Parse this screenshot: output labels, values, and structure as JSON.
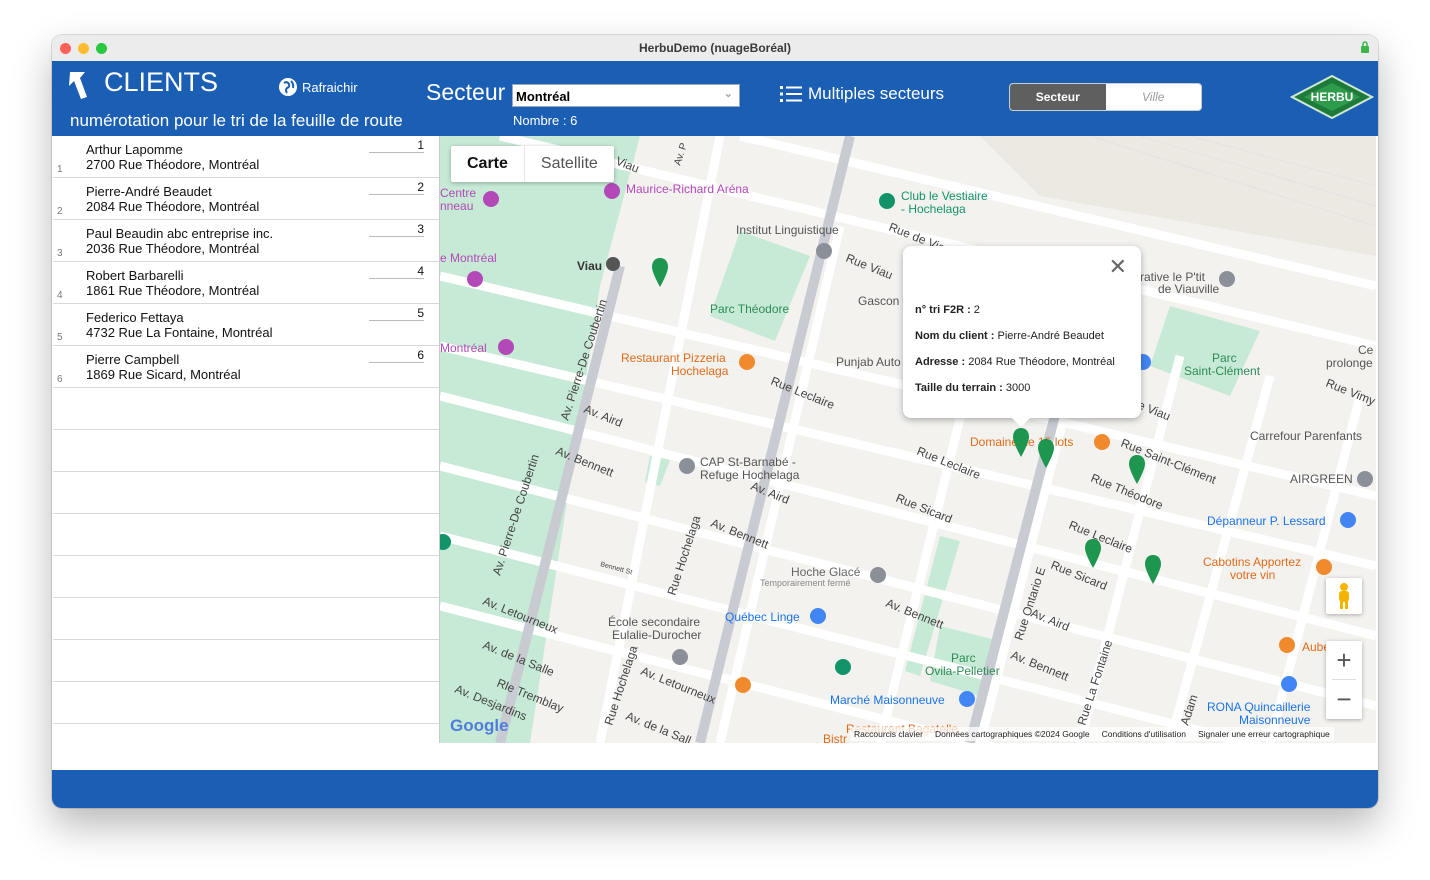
{
  "window": {
    "title": "HerbuDemo (nuageBoréal)"
  },
  "header": {
    "title": "CLIENTS",
    "subtitle": "numérotation pour le tri de la feuille de route",
    "refresh_label": "Rafraichir",
    "secteur_label": "Secteur",
    "secteur_value": "Montréal",
    "count_text": "Nombre : 6",
    "multi_label": "Multiples secteurs",
    "toggle_on": "Secteur",
    "toggle_off": "Ville",
    "logo_text": "HERBU",
    "colors": {
      "header_bg": "#1b5fb5",
      "footer_bg": "#1b5fb5"
    }
  },
  "clients": [
    {
      "rank": "1",
      "name": "Arthur Lapomme",
      "address": "2700 Rue Théodore, Montréal",
      "order": "1"
    },
    {
      "rank": "2",
      "name": "Pierre-André Beaudet",
      "address": "2084 Rue Théodore, Montréal",
      "order": "2"
    },
    {
      "rank": "3",
      "name": "Paul Beaudin abc entreprise inc.",
      "address": "2036 Rue Théodore, Montréal",
      "order": "3"
    },
    {
      "rank": "4",
      "name": "Robert Barbarelli",
      "address": "1861 Rue Théodore, Montréal",
      "order": "4"
    },
    {
      "rank": "5",
      "name": "Federico Fettaya",
      "address": "4732 Rue La Fontaine, Montréal",
      "order": "5"
    },
    {
      "rank": "6",
      "name": "Pierre Campbell",
      "address": "1869 Rue Sicard, Montréal",
      "order": "6"
    }
  ],
  "map": {
    "tab_map": "Carte",
    "tab_satellite": "Satellite",
    "popup": {
      "tri_label": "n° tri F2R :",
      "tri_value": "2",
      "name_label": "Nom du client :",
      "name_value": "Pierre-André Beaudet",
      "address_label": "Adresse :",
      "address_value": "2084 Rue Théodore, Montréal",
      "size_label": "Taille du terrain :",
      "size_value": "3000"
    },
    "google_logo": "Google",
    "attribution": [
      "Raccourcis clavier",
      "Données cartographiques ©2024 Google",
      "Conditions d'utilisation",
      "Signaler une erreur cartographique"
    ],
    "labels": {
      "maurice": "Maurice-Richard Aréna",
      "club1": "Club le Vestiaire",
      "club2": "- Hochelaga",
      "institut": "Institut Linguistique",
      "viau": "Viau",
      "parc_theodore": "Parc Théodore",
      "gascon": "Gascon",
      "punjab": "Punjab Auto",
      "resto1": "Restaurant Pizzeria",
      "resto2": "Hochelaga",
      "rue_leclaire": "Rue Leclaire",
      "av_aird": "Av. Aird",
      "av_bennett": "Av. Bennett",
      "cap1": "CAP St-Barnabé -",
      "cap2": "Refuge Hochelaga",
      "domaine": "Domaine de 15 lots",
      "rue_leclaire2": "Rue Leclaire",
      "rue_sicard": "Rue Sicard",
      "rue_theodore": "Rue Théodore",
      "rue_st_clement": "Rue Saint-Clément",
      "carrefour": "Carrefour Parenfants",
      "airgreen": "AIRGREEN",
      "depanneur": "Dépanneur P. Lessard",
      "cabotins1": "Cabotins Apportez",
      "cabotins2": "votre vin",
      "hoche1": "Hoche Glacé",
      "hoche2": "Temporairement fermé",
      "quebec_linge": "Québec Linge",
      "ecole1": "École secondaire",
      "ecole2": "Eulalie-Durocher",
      "ovila1": "Parc",
      "ovila2": "Ovila-Pelletier",
      "marche": "Marché Maisonneuve",
      "rona1": "RONA Quincaillerie",
      "rona2": "Maisonneuve",
      "coubertin": "Av. Pierre-De Coubertin",
      "coubertin2": "Av. Pierre-De Coubertin",
      "letourneux": "Av. Letourneux",
      "delasalle": "Av. de la Salle",
      "tremblay": "Rle Tremblay",
      "desjardins": "Av. Desjardins",
      "rue_hochelaga": "Rue Hochelaga",
      "rue_ontario": "Rue Ontario E",
      "rue_lafontaine": "Rue La Fontaine",
      "adam": "Adam",
      "rue_viau": "Rue Viau",
      "rue_de_viau": "Rue de Viau",
      "parc_st_clement1": "Parc",
      "parc_st_clement2": "Saint-Clément",
      "centre1": "Centre",
      "centre2": "nneau",
      "montreal1": "e Montréal",
      "montreal2": "Montréal",
      "rative1": "rative le P'tit",
      "rative2": "de Viauville",
      "ce1": "Ce",
      "ce2": "prolonge",
      "rue_vimy": "Rue Vimy",
      "aube": "Aube",
      "bagatelle": "Restaurant Bagatelle",
      "bistr": "Bistr",
      "bennett_st": "Bennett St",
      "av_p": "Av. P",
      "viau_top": "Viau",
      "av_aird2": "Av. Aird",
      "av_bennett2": "Av. Bennett",
      "av_bennett3": "Av. Bennett",
      "av_aird3": "Av. Aird",
      "av_letourneux2": "Av. Letourneux",
      "av_delasalle2": "Av. de la Sall",
      "rue_hochelaga2": "Rue Hochelaga",
      "rue_sicard2": "Rue Sicard",
      "rue_leclaire3": "Rue Leclaire",
      "rue_viau2": "e Viau",
      "rue_viau3": "Rue Viau"
    }
  }
}
